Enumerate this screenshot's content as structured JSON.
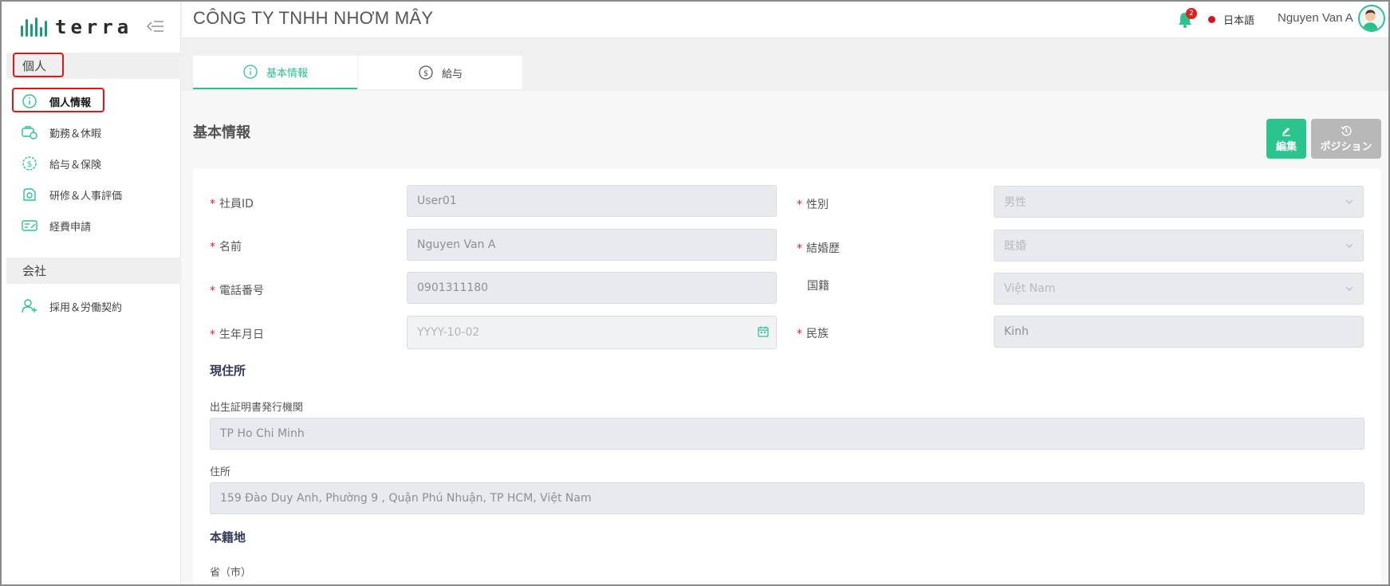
{
  "sidebar": {
    "logo_text": "terra",
    "section_personal": "個人",
    "section_company": "会社",
    "items": [
      {
        "label": "個人情報",
        "icon": "info-icon"
      },
      {
        "label": "勤務＆休暇",
        "icon": "work-leave-icon"
      },
      {
        "label": "給与＆保険",
        "icon": "salary-icon"
      },
      {
        "label": "研修＆人事評価",
        "icon": "training-icon"
      },
      {
        "label": "経費申請",
        "icon": "expense-icon"
      },
      {
        "label": "採用＆労働契約",
        "icon": "add-user-icon"
      }
    ]
  },
  "header": {
    "company_name": "CÔNG TY TNHH NHƠM MÂY",
    "notification_count": "2",
    "language": "日本語",
    "user_name": "Nguyen Van A"
  },
  "tabs": [
    {
      "label": "基本情報",
      "icon": "info-icon",
      "active": true
    },
    {
      "label": "給与",
      "icon": "dollar-icon",
      "active": false
    }
  ],
  "main": {
    "page_title": "基本情報",
    "edit_button": "編集",
    "position_button": "ポジション"
  },
  "form": {
    "employee_id": {
      "label": "社員ID",
      "value": "User01"
    },
    "name": {
      "label": "名前",
      "value": "Nguyen Van A"
    },
    "phone": {
      "label": "電話番号",
      "value": "0901311180"
    },
    "birthday": {
      "label": "生年月日",
      "placeholder": "YYYY-10-02"
    },
    "gender": {
      "label": "性別",
      "value": "男性"
    },
    "marital": {
      "label": "結婚歴",
      "value": "既婚"
    },
    "nationality": {
      "label": "国籍",
      "value": "Việt Nam"
    },
    "ethnicity": {
      "label": "民族",
      "value": "Kinh"
    },
    "current_address_title": "現住所",
    "issuer": {
      "label": "出生証明書発行機関",
      "value": "TP Ho Chi Minh"
    },
    "address": {
      "label": "住所",
      "value": "159 Đào Duy Anh, Phường 9 , Quận Phú Nhuận, TP HCM, Việt Nam"
    },
    "domicile_title": "本籍地",
    "province": {
      "label": "省（市）"
    }
  },
  "colors": {
    "accent": "#2bc48f",
    "highlight_box": "#e01717",
    "required": "#e5212a"
  }
}
